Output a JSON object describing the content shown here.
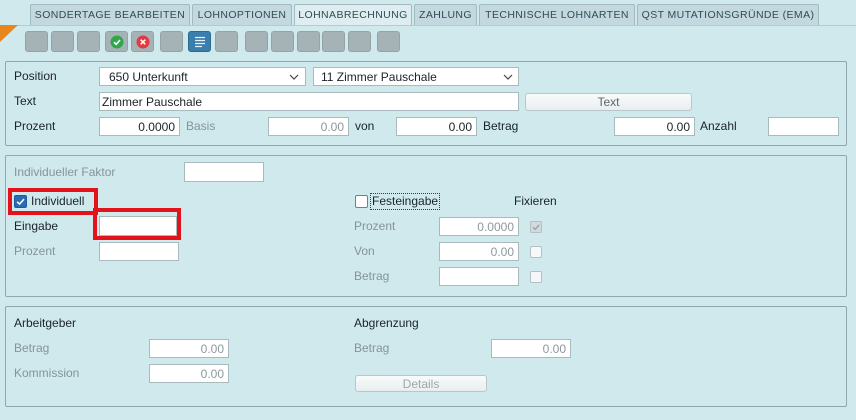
{
  "tabs": [
    {
      "label": "SONDERTAGE BEARBEITEN",
      "active": false
    },
    {
      "label": "LOHNOPTIONEN",
      "active": false
    },
    {
      "label": "LOHNABRECHNUNG",
      "active": true
    },
    {
      "label": "ZAHLUNG",
      "active": false
    },
    {
      "label": "TECHNISCHE LOHNARTEN",
      "active": false
    },
    {
      "label": "QST MUTATIONSGRÜNDE (EMA)",
      "active": false
    }
  ],
  "toolbar": {
    "confirm_icon": "check-circle-icon",
    "cancel_icon": "x-circle-icon",
    "selected_view_icon": "list-icon"
  },
  "colors": {
    "background": "#cfe9ed",
    "panel_border": "#8fa7ad",
    "highlight": "#e3121b",
    "confirm": "#2fa84c",
    "cancel": "#e23a41",
    "active_button": "#3a7ead",
    "checkbox_checked": "#2a6cb4",
    "corner_marker": "#e8861d"
  },
  "position": {
    "label": "Position",
    "lohnart_selected": "650 Unterkunft",
    "subtype_selected": "11 Zimmer Pauschale",
    "text_label": "Text",
    "text_value": "Zimmer Pauschale",
    "text_button": "Text",
    "prozent_label": "Prozent",
    "prozent_value": "0.0000",
    "basis_label": "Basis",
    "basis_value": "0.00",
    "von_label": "von",
    "von_value": "0.00",
    "betrag_label": "Betrag",
    "betrag_value": "0.00",
    "anzahl_label": "Anzahl",
    "anzahl_value": ""
  },
  "faktor": {
    "individueller_faktor_label": "Individueller Faktor",
    "individueller_faktor_value": "",
    "individuell_label": "Individuell",
    "individuell_checked": true,
    "eingabe_label": "Eingabe",
    "eingabe_value": "",
    "prozent_label": "Prozent",
    "prozent_value": "",
    "festeingabe_label": "Festeingabe",
    "festeingabe_checked": false,
    "fixieren_label": "Fixieren",
    "fest_prozent_label": "Prozent",
    "fest_prozent_value": "0.0000",
    "fest_prozent_fixiert": true,
    "fest_von_label": "Von",
    "fest_von_value": "0.00",
    "fest_von_fixiert": false,
    "fest_betrag_label": "Betrag",
    "fest_betrag_value": "",
    "fest_betrag_fixiert": false
  },
  "arbeitgeber": {
    "label": "Arbeitgeber",
    "betrag_label": "Betrag",
    "betrag_value": "0.00",
    "kommission_label": "Kommission",
    "kommission_value": "0.00"
  },
  "abgrenzung": {
    "label": "Abgrenzung",
    "betrag_label": "Betrag",
    "betrag_value": "0.00",
    "details_button": "Details"
  }
}
